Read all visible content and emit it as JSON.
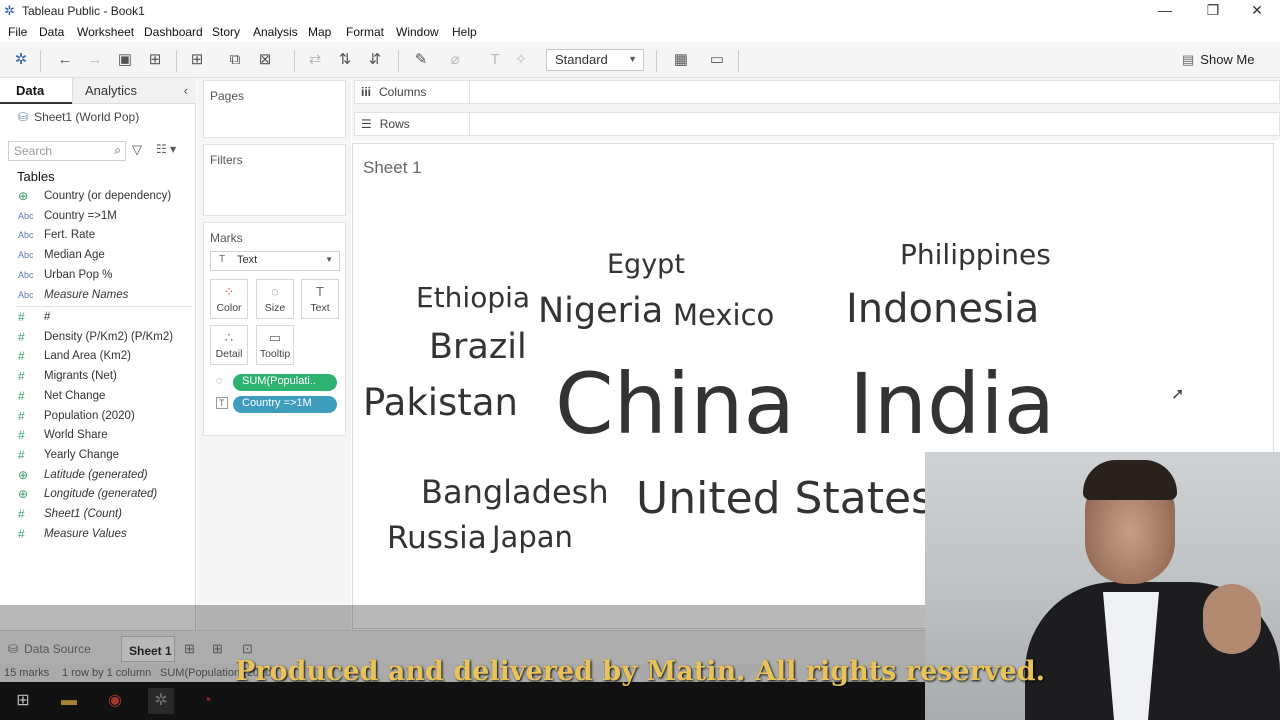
{
  "window": {
    "title": "Tableau Public - Book1",
    "minimize": "—",
    "restore": "❐",
    "close": "✕"
  },
  "menu": [
    "File",
    "Data",
    "Worksheet",
    "Dashboard",
    "Story",
    "Analysis",
    "Map",
    "Format",
    "Window",
    "Help"
  ],
  "toolbar": {
    "fit_select": "Standard",
    "show_me": "Show Me"
  },
  "left_pane": {
    "tab_data": "Data",
    "tab_analytics": "Analytics",
    "datasource": "Sheet1 (World Pop)",
    "search_placeholder": "Search",
    "tables_header": "Tables",
    "dimensions": [
      {
        "icon": "globe",
        "glyph": "⊕",
        "label": "Country (or dependency)"
      },
      {
        "icon": "abc",
        "glyph": "Abc",
        "label": "Country =>1M"
      },
      {
        "icon": "abc",
        "glyph": "Abc",
        "label": "Fert. Rate"
      },
      {
        "icon": "abc",
        "glyph": "Abc",
        "label": "Median Age"
      },
      {
        "icon": "abc",
        "glyph": "Abc",
        "label": "Urban Pop %"
      },
      {
        "icon": "abc",
        "glyph": "Abc",
        "label": "Measure Names",
        "italic": true
      }
    ],
    "measures": [
      {
        "icon": "hash",
        "glyph": "#",
        "label": "#"
      },
      {
        "icon": "hash",
        "glyph": "#",
        "label": "Density (P/Km2) (P/Km2)"
      },
      {
        "icon": "hash",
        "glyph": "#",
        "label": "Land Area (Km2)"
      },
      {
        "icon": "hash",
        "glyph": "#",
        "label": "Migrants (Net)"
      },
      {
        "icon": "hash",
        "glyph": "#",
        "label": "Net Change"
      },
      {
        "icon": "hash",
        "glyph": "#",
        "label": "Population (2020)"
      },
      {
        "icon": "hash",
        "glyph": "#",
        "label": "World Share"
      },
      {
        "icon": "hash",
        "glyph": "#",
        "label": "Yearly Change"
      },
      {
        "icon": "globe",
        "glyph": "⊕",
        "label": "Latitude (generated)",
        "italic": true
      },
      {
        "icon": "globe",
        "glyph": "⊕",
        "label": "Longitude (generated)",
        "italic": true
      },
      {
        "icon": "hash",
        "glyph": "#",
        "label": "Sheet1 (Count)",
        "italic": true
      },
      {
        "icon": "hash",
        "glyph": "#",
        "label": "Measure Values",
        "italic": true
      }
    ]
  },
  "cards": {
    "pages": "Pages",
    "filters": "Filters",
    "marks": "Marks",
    "mark_type": "Text",
    "buttons": {
      "color": "Color",
      "size": "Size",
      "text": "Text",
      "detail": "Detail",
      "tooltip": "Tooltip"
    },
    "pill_size": "SUM(Populati..",
    "pill_text": "Country =>1M",
    "pill_size_color": "#2db36f",
    "pill_text_color": "#3e9cbf"
  },
  "shelves": {
    "columns": "Columns",
    "rows": "Rows",
    "columns_icon": "iii",
    "rows_icon": "☰"
  },
  "sheet": {
    "title": "Sheet 1",
    "words": [
      {
        "text": "China",
        "size": 84
      },
      {
        "text": "India",
        "size": 84
      },
      {
        "text": "United States",
        "size": 44
      },
      {
        "text": "Indonesia",
        "size": 40
      },
      {
        "text": "Pakistan",
        "size": 37
      },
      {
        "text": "Brazil",
        "size": 35
      },
      {
        "text": "Nigeria",
        "size": 35
      },
      {
        "text": "Bangladesh",
        "size": 32
      },
      {
        "text": "Russia",
        "size": 31
      },
      {
        "text": "Mexico",
        "size": 29
      },
      {
        "text": "Japan",
        "size": 29
      },
      {
        "text": "Ethiopia",
        "size": 28
      },
      {
        "text": "Philippines",
        "size": 28
      },
      {
        "text": "Egypt",
        "size": 27
      }
    ]
  },
  "bottom": {
    "data_source_tab": "Data Source",
    "sheet_tab": "Sheet 1",
    "status_marks": "15 marks",
    "status_rows": "1 row by 1 column",
    "status_sum": "SUM(Population (2020)"
  },
  "caption": "Produced and delivered by Matin. All rights reserved."
}
